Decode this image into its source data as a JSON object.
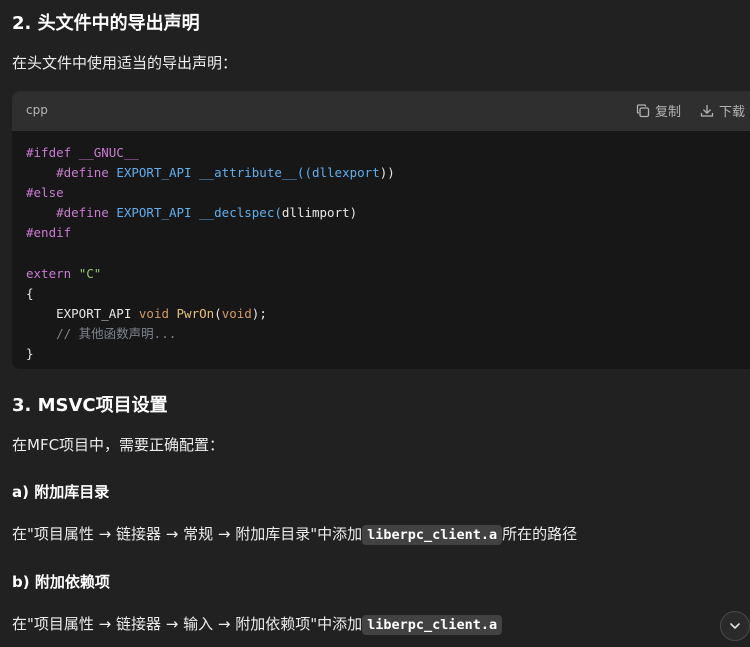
{
  "section2": {
    "heading": "2. 头文件中的导出声明",
    "intro": "在头文件中使用适当的导出声明："
  },
  "code_block": {
    "language": "cpp",
    "copy_label": "复制",
    "download_label": "下载",
    "lines": {
      "l1": "#ifdef __GNUC__",
      "l2a": "    #define ",
      "l2b": "EXPORT_API __attribute__((",
      "l2c": "dllexport",
      "l2d": "))",
      "l3": "#else",
      "l4a": "    #define ",
      "l4b": "EXPORT_API __declspec(",
      "l4c": "dllimport",
      "l4d": ")",
      "l5": "#endif",
      "l7a": "extern ",
      "l7b": "\"C\"",
      "l8": "{",
      "l9a": "    EXPORT_API ",
      "l9b": "void",
      "l9c": " PwrOn",
      "l9d": "(",
      "l9e": "void",
      "l9f": ");",
      "l10": "    // 其他函数声明...",
      "l11": "}"
    }
  },
  "section3": {
    "heading": "3. MSVC项目设置",
    "intro": "在MFC项目中，需要正确配置：",
    "sub_a": {
      "heading": "a) 附加库目录",
      "text_before": "在\"项目属性 → 链接器 → 常规 → 附加库目录\"中添加",
      "code": "liberpc_client.a",
      "text_after": "所在的路径"
    },
    "sub_b": {
      "heading": "b) 附加依赖项",
      "text_before": "在\"项目属性 → 链接器 → 输入 → 附加依赖项\"中添加",
      "code": "liberpc_client.a"
    }
  },
  "icons": {
    "copy": "copy-icon",
    "download": "download-icon",
    "scroll_down": "chevron-down-icon"
  }
}
